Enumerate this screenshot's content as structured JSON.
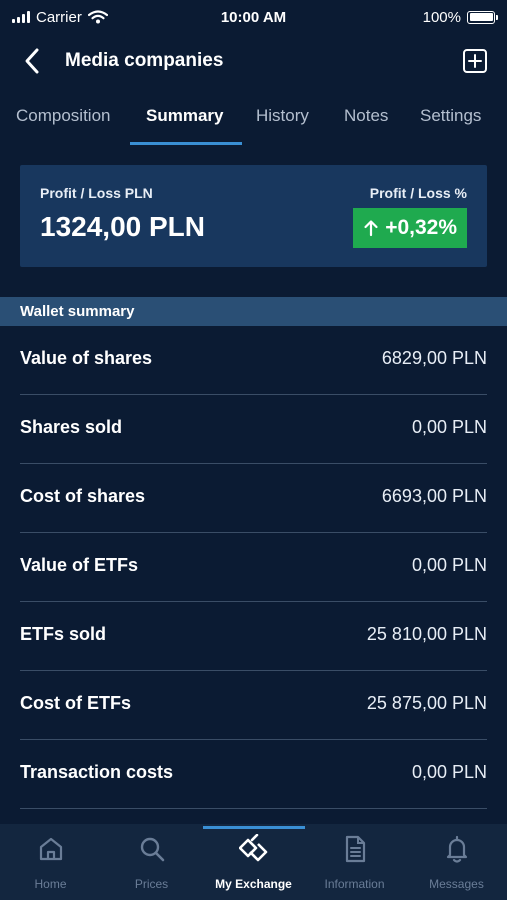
{
  "status_bar": {
    "carrier": "Carrier",
    "time": "10:00 AM",
    "battery": "100%"
  },
  "header": {
    "title": "Media companies",
    "back_icon": "chevron-left-icon",
    "add_icon": "plus-square-icon"
  },
  "tabs": [
    {
      "label": "Composition",
      "active": false
    },
    {
      "label": "Summary",
      "active": true
    },
    {
      "label": "History",
      "active": false
    },
    {
      "label": "Notes",
      "active": false
    },
    {
      "label": "Settings",
      "active": false
    }
  ],
  "profit_card": {
    "pl_label": "Profit / Loss PLN",
    "pl_value": "1324,00 PLN",
    "pct_label": "Profit / Loss %",
    "pct_value": "+0,32%",
    "pct_color": "#1faa4f"
  },
  "wallet": {
    "section_title": "Wallet summary",
    "rows": [
      {
        "label": "Value of shares",
        "value": "6829,00 PLN"
      },
      {
        "label": "Shares sold",
        "value": "0,00 PLN"
      },
      {
        "label": "Cost of shares",
        "value": "6693,00 PLN"
      },
      {
        "label": "Value of ETFs",
        "value": "0,00 PLN"
      },
      {
        "label": "ETFs sold",
        "value": "25 810,00 PLN"
      },
      {
        "label": "Cost of ETFs",
        "value": "25 875,00 PLN"
      },
      {
        "label": "Transaction costs",
        "value": "0,00 PLN"
      }
    ]
  },
  "tabbar": [
    {
      "label": "Home",
      "icon": "home-icon",
      "active": false
    },
    {
      "label": "Prices",
      "icon": "search-icon",
      "active": false
    },
    {
      "label": "My Exchange",
      "icon": "exchange-logo-icon",
      "active": true
    },
    {
      "label": "Information",
      "icon": "document-icon",
      "active": false
    },
    {
      "label": "Messages",
      "icon": "bell-icon",
      "active": false
    }
  ],
  "colors": {
    "background": "#0b1b33",
    "card": "#18375e",
    "section": "#2a4f75",
    "accent": "#3a8fd4",
    "positive": "#1faa4f",
    "tabbar": "#13263f"
  }
}
